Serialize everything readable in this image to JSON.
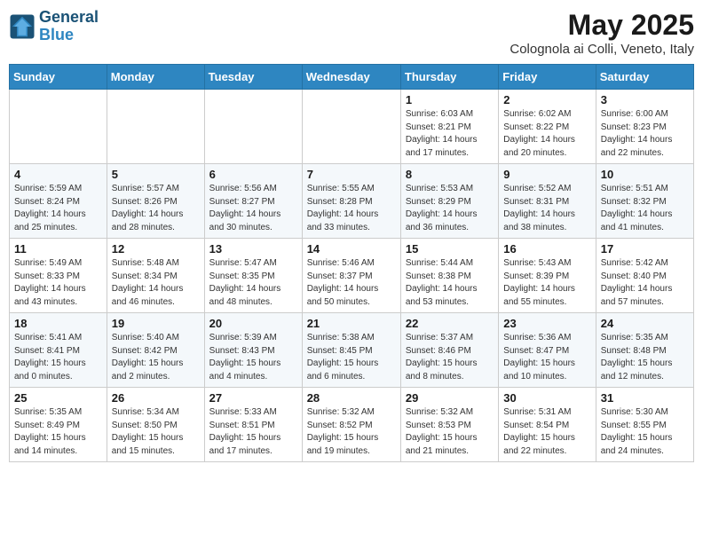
{
  "logo": {
    "line1": "General",
    "line2": "Blue"
  },
  "title": "May 2025",
  "subtitle": "Colognola ai Colli, Veneto, Italy",
  "days_of_week": [
    "Sunday",
    "Monday",
    "Tuesday",
    "Wednesday",
    "Thursday",
    "Friday",
    "Saturday"
  ],
  "weeks": [
    [
      {
        "day": "",
        "info": ""
      },
      {
        "day": "",
        "info": ""
      },
      {
        "day": "",
        "info": ""
      },
      {
        "day": "",
        "info": ""
      },
      {
        "day": "1",
        "info": "Sunrise: 6:03 AM\nSunset: 8:21 PM\nDaylight: 14 hours\nand 17 minutes."
      },
      {
        "day": "2",
        "info": "Sunrise: 6:02 AM\nSunset: 8:22 PM\nDaylight: 14 hours\nand 20 minutes."
      },
      {
        "day": "3",
        "info": "Sunrise: 6:00 AM\nSunset: 8:23 PM\nDaylight: 14 hours\nand 22 minutes."
      }
    ],
    [
      {
        "day": "4",
        "info": "Sunrise: 5:59 AM\nSunset: 8:24 PM\nDaylight: 14 hours\nand 25 minutes."
      },
      {
        "day": "5",
        "info": "Sunrise: 5:57 AM\nSunset: 8:26 PM\nDaylight: 14 hours\nand 28 minutes."
      },
      {
        "day": "6",
        "info": "Sunrise: 5:56 AM\nSunset: 8:27 PM\nDaylight: 14 hours\nand 30 minutes."
      },
      {
        "day": "7",
        "info": "Sunrise: 5:55 AM\nSunset: 8:28 PM\nDaylight: 14 hours\nand 33 minutes."
      },
      {
        "day": "8",
        "info": "Sunrise: 5:53 AM\nSunset: 8:29 PM\nDaylight: 14 hours\nand 36 minutes."
      },
      {
        "day": "9",
        "info": "Sunrise: 5:52 AM\nSunset: 8:31 PM\nDaylight: 14 hours\nand 38 minutes."
      },
      {
        "day": "10",
        "info": "Sunrise: 5:51 AM\nSunset: 8:32 PM\nDaylight: 14 hours\nand 41 minutes."
      }
    ],
    [
      {
        "day": "11",
        "info": "Sunrise: 5:49 AM\nSunset: 8:33 PM\nDaylight: 14 hours\nand 43 minutes."
      },
      {
        "day": "12",
        "info": "Sunrise: 5:48 AM\nSunset: 8:34 PM\nDaylight: 14 hours\nand 46 minutes."
      },
      {
        "day": "13",
        "info": "Sunrise: 5:47 AM\nSunset: 8:35 PM\nDaylight: 14 hours\nand 48 minutes."
      },
      {
        "day": "14",
        "info": "Sunrise: 5:46 AM\nSunset: 8:37 PM\nDaylight: 14 hours\nand 50 minutes."
      },
      {
        "day": "15",
        "info": "Sunrise: 5:44 AM\nSunset: 8:38 PM\nDaylight: 14 hours\nand 53 minutes."
      },
      {
        "day": "16",
        "info": "Sunrise: 5:43 AM\nSunset: 8:39 PM\nDaylight: 14 hours\nand 55 minutes."
      },
      {
        "day": "17",
        "info": "Sunrise: 5:42 AM\nSunset: 8:40 PM\nDaylight: 14 hours\nand 57 minutes."
      }
    ],
    [
      {
        "day": "18",
        "info": "Sunrise: 5:41 AM\nSunset: 8:41 PM\nDaylight: 15 hours\nand 0 minutes."
      },
      {
        "day": "19",
        "info": "Sunrise: 5:40 AM\nSunset: 8:42 PM\nDaylight: 15 hours\nand 2 minutes."
      },
      {
        "day": "20",
        "info": "Sunrise: 5:39 AM\nSunset: 8:43 PM\nDaylight: 15 hours\nand 4 minutes."
      },
      {
        "day": "21",
        "info": "Sunrise: 5:38 AM\nSunset: 8:45 PM\nDaylight: 15 hours\nand 6 minutes."
      },
      {
        "day": "22",
        "info": "Sunrise: 5:37 AM\nSunset: 8:46 PM\nDaylight: 15 hours\nand 8 minutes."
      },
      {
        "day": "23",
        "info": "Sunrise: 5:36 AM\nSunset: 8:47 PM\nDaylight: 15 hours\nand 10 minutes."
      },
      {
        "day": "24",
        "info": "Sunrise: 5:35 AM\nSunset: 8:48 PM\nDaylight: 15 hours\nand 12 minutes."
      }
    ],
    [
      {
        "day": "25",
        "info": "Sunrise: 5:35 AM\nSunset: 8:49 PM\nDaylight: 15 hours\nand 14 minutes."
      },
      {
        "day": "26",
        "info": "Sunrise: 5:34 AM\nSunset: 8:50 PM\nDaylight: 15 hours\nand 15 minutes."
      },
      {
        "day": "27",
        "info": "Sunrise: 5:33 AM\nSunset: 8:51 PM\nDaylight: 15 hours\nand 17 minutes."
      },
      {
        "day": "28",
        "info": "Sunrise: 5:32 AM\nSunset: 8:52 PM\nDaylight: 15 hours\nand 19 minutes."
      },
      {
        "day": "29",
        "info": "Sunrise: 5:32 AM\nSunset: 8:53 PM\nDaylight: 15 hours\nand 21 minutes."
      },
      {
        "day": "30",
        "info": "Sunrise: 5:31 AM\nSunset: 8:54 PM\nDaylight: 15 hours\nand 22 minutes."
      },
      {
        "day": "31",
        "info": "Sunrise: 5:30 AM\nSunset: 8:55 PM\nDaylight: 15 hours\nand 24 minutes."
      }
    ]
  ]
}
